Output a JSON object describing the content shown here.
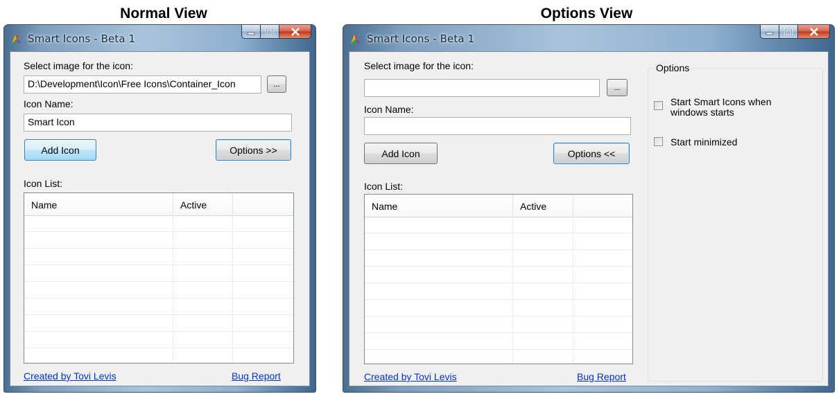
{
  "captions": {
    "normal": "Normal View",
    "options": "Options View"
  },
  "windows": [
    {
      "title": "Smart Icons - Beta 1",
      "select_label": "Select image for the icon:",
      "image_path": "D:\\Development\\Icon\\Free Icons\\Container_Icon",
      "browse_label": "...",
      "name_label": "Icon Name:",
      "icon_name": "Smart Icon",
      "add_label": "Add Icon",
      "options_label": "Options >>",
      "list_label": "Icon List:",
      "columns": [
        "Name",
        "Active",
        ""
      ],
      "created_link": "Created by Tovi Levis",
      "bug_link": "Bug Report"
    },
    {
      "title": "Smart Icons - Beta 1",
      "select_label": "Select image for the icon:",
      "image_path": "",
      "browse_label": "...",
      "name_label": "Icon Name:",
      "icon_name": "",
      "add_label": "Add Icon",
      "options_label": "Options <<",
      "list_label": "Icon List:",
      "columns": [
        "Name",
        "Active",
        ""
      ],
      "created_link": "Created by Tovi Levis",
      "bug_link": "Bug Report",
      "options": {
        "group_title": "Options",
        "start_with_windows_line1": "Start Smart Icons when",
        "start_with_windows_line2": "windows starts",
        "start_with_windows_checked": false,
        "start_minimized": "Start minimized",
        "start_minimized_checked": false
      }
    }
  ],
  "colors": {
    "link": "#0033cc",
    "focus_border": "#3c7fb1",
    "close_button": "#c2351c"
  },
  "icons": [
    "app-icon",
    "minimize-icon",
    "maximize-icon",
    "close-icon"
  ]
}
